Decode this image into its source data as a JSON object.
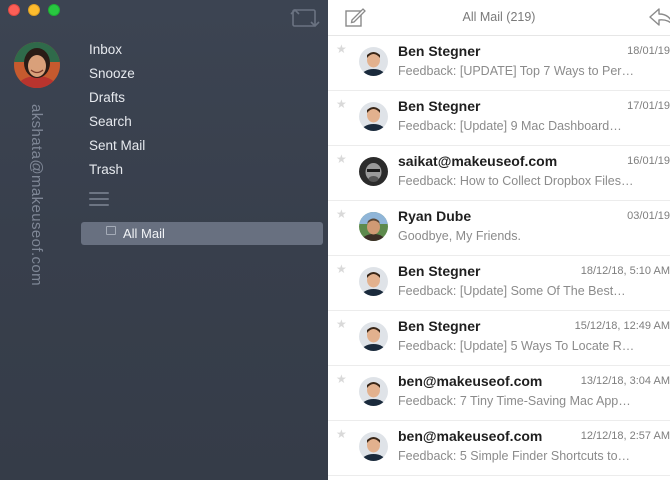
{
  "window": {
    "controls": [
      "close",
      "minimize",
      "maximize"
    ]
  },
  "sidebar": {
    "account_email": "akshata@makeuseof.com",
    "nav_items": [
      {
        "label": "Inbox"
      },
      {
        "label": "Snooze"
      },
      {
        "label": "Drafts"
      },
      {
        "label": "Search"
      },
      {
        "label": "Sent Mail"
      },
      {
        "label": "Trash"
      }
    ],
    "selected_folder": "All Mail",
    "icons": {
      "layout": "layout-toggle-icon",
      "menu": "hamburger-menu-icon",
      "folder": "folder-icon"
    }
  },
  "toolbar": {
    "title": "All Mail (219)",
    "icons": {
      "compose": "compose-icon",
      "reply": "reply-icon"
    }
  },
  "mail_list": [
    {
      "sender": "Ben Stegner",
      "subject": "Feedback: [UPDATE] Top 7 Ways to Per…",
      "date": "18/01/19",
      "avatar": "ben"
    },
    {
      "sender": "Ben Stegner",
      "subject": "Feedback: [Update] 9 Mac Dashboard…",
      "date": "17/01/19",
      "avatar": "ben"
    },
    {
      "sender": "saikat@makeuseof.com",
      "subject": "Feedback: How to Collect Dropbox Files…",
      "date": "16/01/19",
      "avatar": "saikat"
    },
    {
      "sender": "Ryan Dube",
      "subject": "Goodbye, My Friends.",
      "date": "03/01/19",
      "avatar": "ryan"
    },
    {
      "sender": "Ben Stegner",
      "subject": "Feedback: [Update] Some Of The Best…",
      "date": "18/12/18, 5:10 AM",
      "avatar": "ben"
    },
    {
      "sender": "Ben Stegner",
      "subject": "Feedback: [Update] 5 Ways To Locate R…",
      "date": "15/12/18, 12:49 AM",
      "avatar": "ben"
    },
    {
      "sender": "ben@makeuseof.com",
      "subject": "Feedback: 7 Tiny Time-Saving Mac App…",
      "date": "13/12/18, 3:04 AM",
      "avatar": "ben"
    },
    {
      "sender": "ben@makeuseof.com",
      "subject": "Feedback: 5 Simple Finder Shortcuts to…",
      "date": "12/12/18, 2:57 AM",
      "avatar": "ben"
    }
  ],
  "colors": {
    "sidebar_bg": "#3a414e",
    "selected_bg": "#687080",
    "sender_text": "#1f1f1f",
    "subject_text": "#8b8b8b"
  }
}
